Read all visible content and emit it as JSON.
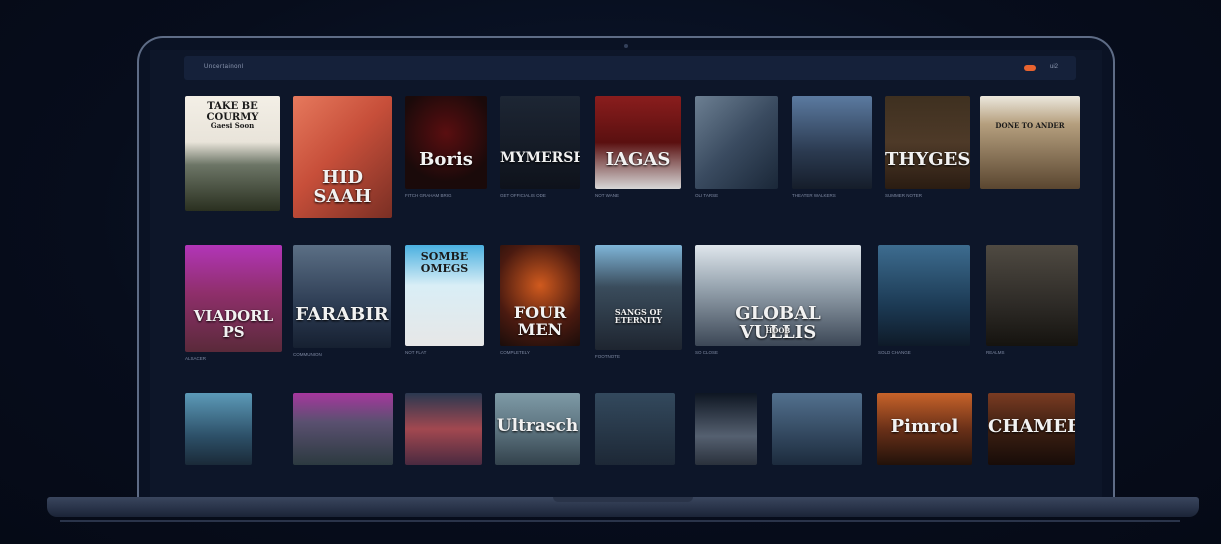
{
  "app": {
    "title": "Uncertainonl"
  },
  "topbar": {
    "badge_color": "#e8632f",
    "right_label": "ui2"
  },
  "rows": [
    [
      {
        "title": "TAKE BE COURMY",
        "sub": "Gaesi Soon",
        "meta": "",
        "bg": "linear-gradient(#f3efe6 0%, #e9e4da 40%, #6c7566 60%, #2a3020 100%)",
        "dark": true
      },
      {
        "title": "HID SAAH",
        "sub": "",
        "meta": "",
        "bg": "linear-gradient(135deg,#e6795d 0%,#c74f3a 45%,#7a2f24 100%)",
        "dark": false
      },
      {
        "title": "Boris",
        "sub": "",
        "meta": "FITCH GRAHAM BRIG",
        "bg": "radial-gradient(circle at 50% 40%,#5a0e10 0%,#1a0a0a 70%)",
        "dark": false
      },
      {
        "title": "MYMERSHEN",
        "sub": "",
        "meta": "GET OFFICIALIS ODE",
        "bg": "linear-gradient(#1d2634 0%,#0e121b 100%)",
        "dark": false
      },
      {
        "title": "IAGAS",
        "sub": "",
        "meta": "NOT WANE",
        "bg": "linear-gradient(#8a1d1d 0%,#5a1010 50%,#d7d7d7 100%)",
        "dark": false
      },
      {
        "title": "",
        "sub": "",
        "meta": "OLI TARSE",
        "bg": "linear-gradient(135deg,#6c7f92 0%,#3a4b60 50%,#1a2738 100%)",
        "dark": false
      },
      {
        "title": "",
        "sub": "",
        "meta": "THEATER WALKERS",
        "bg": "linear-gradient(#5b7aa0 0%,#2b3a50 60%,#151d2a 100%)",
        "dark": false
      },
      {
        "title": "THYGESH",
        "sub": "",
        "meta": "SUMMER NOTER",
        "bg": "linear-gradient(#3e3020 0%,#4e3a28 50%,#2a1c12 100%)",
        "dark": false
      },
      {
        "title": "",
        "sub": "DONE TO ANDER",
        "meta": "",
        "bg": "linear-gradient(#ece8dd 0%,#b59f7e 30%,#5a4630 100%)",
        "dark": true
      }
    ],
    [
      {
        "title": "VIADORL PS",
        "sub": "",
        "meta": "ALSACER",
        "bg": "linear-gradient(#b235b8 0%,#8f2f6b 45%,#5a2a3a 100%)",
        "dark": false
      },
      {
        "title": "FARABIR",
        "sub": "",
        "meta": "COMMUNION",
        "bg": "linear-gradient(#5b6f85 0%,#2c3b52 60%,#162031 100%)",
        "dark": false
      },
      {
        "title": "SOMBE OMEGS",
        "sub": "",
        "meta": "NOT FLAT",
        "bg": "linear-gradient(#4ab0e0 0%,#d9eef6 40%,#e7e7e7 100%)",
        "dark": true
      },
      {
        "title": "FOUR MEN",
        "sub": "",
        "meta": "COMPLETELY",
        "bg": "radial-gradient(circle at 50% 40%,#d05a1e 0%,#4a1a10 60%,#1a0d0a 100%)",
        "dark": false
      },
      {
        "title": "SANGS OF ETERNITY",
        "sub": "",
        "meta": "FOOTNOTE",
        "bg": "linear-gradient(#7fb5d8 0%,#3a4c5c 40%,#1e2530 100%)",
        "dark": false
      },
      {
        "title": "GLOBAL VULLIS",
        "sub": "HOOB",
        "meta": "SO CLOSE",
        "bg": "linear-gradient(#dfe6ec 0%,#9aa7b2 40%,#3c4756 100%)",
        "dark": false
      },
      {
        "title": "",
        "sub": "",
        "meta": "SOLD CHANGE",
        "bg": "linear-gradient(#3d6c8f 0%,#1c3a54 60%,#0e1a28 100%)",
        "dark": false
      },
      {
        "title": "",
        "sub": "",
        "meta": "REALMS",
        "bg": "linear-gradient(#4f4a42 0%,#2d2a26 60%,#15130f 100%)",
        "dark": false
      }
    ],
    [
      {
        "title": "",
        "sub": "",
        "meta": "",
        "bg": "linear-gradient(#5c9ab8 0%,#2d5068 60%,#1a2a38 100%)",
        "dark": false
      },
      {
        "title": "",
        "sub": "",
        "meta": "",
        "bg": "linear-gradient(#a6379e 0%,#5a5070 40%,#2c3a40 100%)",
        "dark": false
      },
      {
        "title": "",
        "sub": "",
        "meta": "",
        "bg": "linear-gradient(#2a3850 0%,#a24850 50%,#4a2a40 100%)",
        "dark": false
      },
      {
        "title": "Ultrasch",
        "sub": "",
        "meta": "",
        "bg": "linear-gradient(#7e9aa6 0%,#5d7480 50%,#33424c 100%)",
        "dark": false
      },
      {
        "title": "",
        "sub": "",
        "meta": "",
        "bg": "linear-gradient(#33495d 0%,#1d2836 100%)",
        "dark": false
      },
      {
        "title": "",
        "sub": "",
        "meta": "",
        "bg": "linear-gradient(#0e1622 0%,#556070 60%,#2a313c 100%)",
        "dark": false
      },
      {
        "title": "",
        "sub": "",
        "meta": "",
        "bg": "linear-gradient(#52708e 0%,#1c2b3d 100%)",
        "dark": false
      },
      {
        "title": "Pimrol",
        "sub": "",
        "meta": "",
        "bg": "linear-gradient(#c7632a 0%,#6a3018 50%,#22120a 100%)",
        "dark": false
      },
      {
        "title": "CHAMEEN",
        "sub": "",
        "meta": "",
        "bg": "linear-gradient(#7a3b22 0%,#3c1f12 50%,#180c08 100%)",
        "dark": false
      }
    ]
  ]
}
